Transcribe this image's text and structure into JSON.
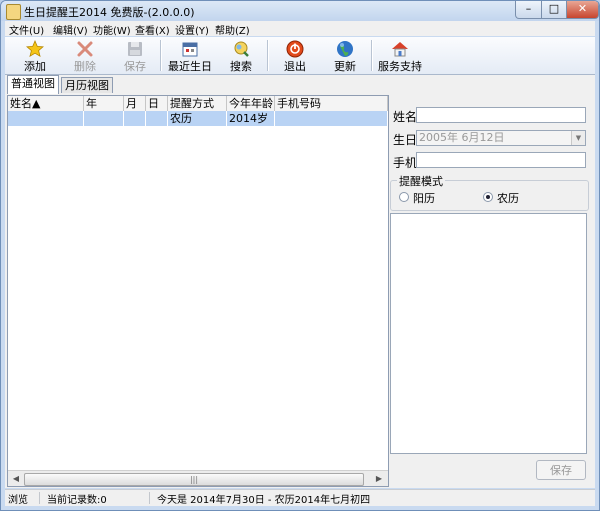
{
  "window": {
    "title": "生日提醒王2014 免费版-(2.0.0.0)",
    "controls": {
      "minimize": "–",
      "maximize": "□",
      "close": "✕"
    }
  },
  "menu": [
    "文件(U)",
    "编辑(V)",
    "功能(W)",
    "查看(X)",
    "设置(Y)",
    "帮助(Z)"
  ],
  "toolbar": {
    "add": {
      "label": "添加",
      "icon": "star-icon"
    },
    "delete": {
      "label": "删除",
      "icon": "x-icon"
    },
    "save": {
      "label": "保存",
      "icon": "floppy-icon"
    },
    "recent": {
      "label": "最近生日",
      "icon": "calendar-icon"
    },
    "search": {
      "label": "搜索",
      "icon": "search-icon"
    },
    "exit": {
      "label": "退出",
      "icon": "power-icon"
    },
    "update": {
      "label": "更新",
      "icon": "globe-icon"
    },
    "support": {
      "label": "服务支持",
      "icon": "home-icon"
    }
  },
  "tabs": [
    "普通视图",
    "月历视图"
  ],
  "table": {
    "columns": [
      "姓名▲",
      "年",
      "月",
      "日",
      "提醒方式",
      "今年年龄",
      "手机号码"
    ],
    "rows": [
      [
        "",
        "",
        "",
        "",
        "农历",
        "2014岁",
        ""
      ]
    ]
  },
  "form": {
    "name_label": "姓名",
    "name_value": "",
    "birthday_label": "生日",
    "birthday_value": "2005年  6月12日",
    "phone_label": "手机",
    "phone_value": "",
    "mode_title": "提醒模式",
    "mode_solar": "阳历",
    "mode_lunar": "农历",
    "selected_mode": "lunar",
    "save_label": "保存"
  },
  "status": {
    "mode": "浏览",
    "records": "当前记录数:0",
    "today": "今天是 2014年7月30日 - 农历2014年七月初四"
  },
  "colors": {
    "selection": "#b9d3f4",
    "frame": "#c9daf0"
  }
}
